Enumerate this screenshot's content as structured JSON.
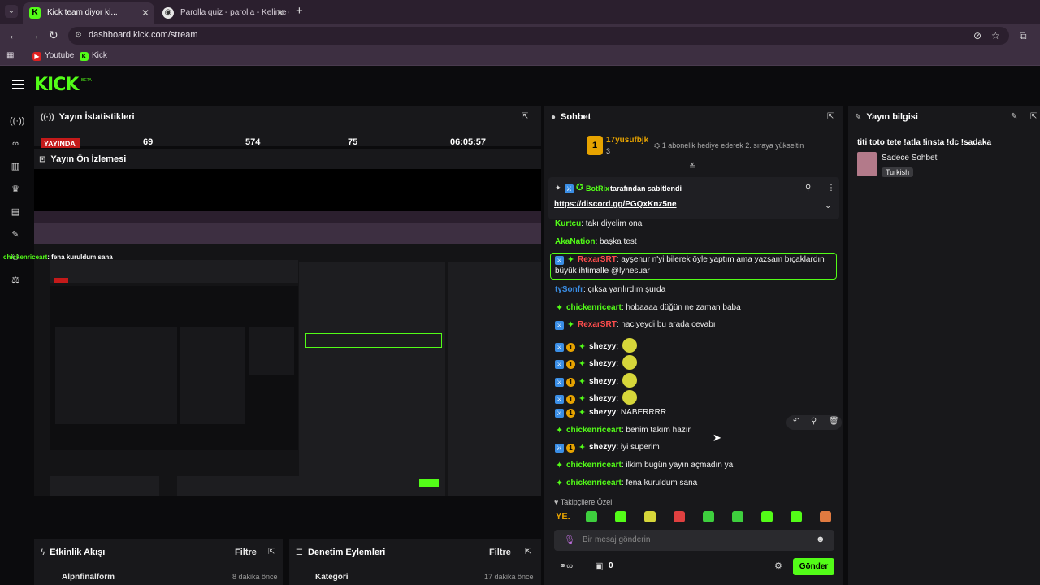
{
  "browser": {
    "tabs": [
      {
        "title": "Kick team diyor ki...",
        "active": true
      },
      {
        "title": "Parolla quiz - parolla - Kelime o",
        "active": false
      }
    ],
    "url": "dashboard.kick.com/stream",
    "bookmarks": [
      "Youtube",
      "Kick"
    ]
  },
  "app": {
    "logo": "KICK",
    "beta": "BETA"
  },
  "stats_panel": {
    "title": "Yayın İstatistikleri",
    "live_label": "YAYINDA",
    "values": [
      "69",
      "574",
      "75",
      "06:05:57"
    ]
  },
  "preview_panel": {
    "title": "Yayın Ön İzlemesi",
    "overlay_user": "chickenriceart",
    "overlay_message": "fena kuruldum sana"
  },
  "chat": {
    "title": "Sohbet",
    "top_gifter": {
      "name": "17yusufbjk",
      "count": "3"
    },
    "gift_prompt": "1 abonelik hediye ederek 2. sıraya yükseltin",
    "pinned": {
      "by_user": "BotRix",
      "by_label": "tarafından sabitlendi",
      "link": "https://discord.gg/PGQxKnz5ne"
    },
    "messages": [
      {
        "user": "Kurtcu",
        "text": "takı diyelim ona",
        "color": "#53fc18"
      },
      {
        "user": "AkaNation",
        "text": "başka test",
        "color": "#53fc18"
      },
      {
        "user": "RexarSRT",
        "text": "ayşenur n'yi bilerek öyle yaptım ama yazsam bıçaklardın",
        "text2": "büyük ihtimalle @lynesuar",
        "color": "#ff4d4d"
      },
      {
        "user": "tySonfr",
        "text": "çıksa yarılırdım şurda",
        "color": "#3a8ee6"
      },
      {
        "user": "chickenriceart",
        "text": "hobaaaa düğün ne zaman baba",
        "color": "#53fc18"
      },
      {
        "user": "RexarSRT",
        "text": "naciyeydi bu arada cevabı",
        "color": "#ff4d4d"
      },
      {
        "user": "shezyy",
        "text": "",
        "color": "#ffffff"
      },
      {
        "user": "shezyy",
        "text": "",
        "color": "#ffffff"
      },
      {
        "user": "shezyy",
        "text": "",
        "color": "#ffffff"
      },
      {
        "user": "shezyy",
        "text": "",
        "color": "#ffffff"
      },
      {
        "user": "shezyy",
        "text": "NABERRRR",
        "color": "#ffffff"
      },
      {
        "user": "chickenriceart",
        "text": "benim takım hazır",
        "color": "#53fc18"
      },
      {
        "user": "shezyy",
        "text": "iyi süperim",
        "color": "#ffffff"
      },
      {
        "user": "chickenriceart",
        "text": "ilkim bugün yayın açmadın ya",
        "color": "#53fc18"
      },
      {
        "user": "chickenriceart",
        "text": "fena kuruldum sana",
        "color": "#53fc18"
      }
    ],
    "followers_only_label": "Takipçilere Özel",
    "emote_label": "YE.",
    "input_placeholder": "Bir mesaj gönderin",
    "footer_count": "0",
    "send_label": "Gönder"
  },
  "info_panel": {
    "title": "Yayın bilgisi",
    "stream_title": "titi toto tete !atla !insta !dc !sadaka",
    "category": "Sadece Sohbet",
    "language_tag": "Turkish"
  },
  "activity_panel": {
    "title": "Etkinlik Akışı",
    "filter": "Filtre",
    "row_user": "Alpnfinalform",
    "row_time": "8 dakika önce"
  },
  "moderation_panel": {
    "title": "Denetim Eylemleri",
    "filter": "Filtre",
    "row_label": "Kategori",
    "row_time": "17 dakika önce"
  },
  "colors": {
    "brand": "#53fc18",
    "live": "#c41a1a",
    "panel": "#18181b",
    "background": "#0b0b0d"
  }
}
